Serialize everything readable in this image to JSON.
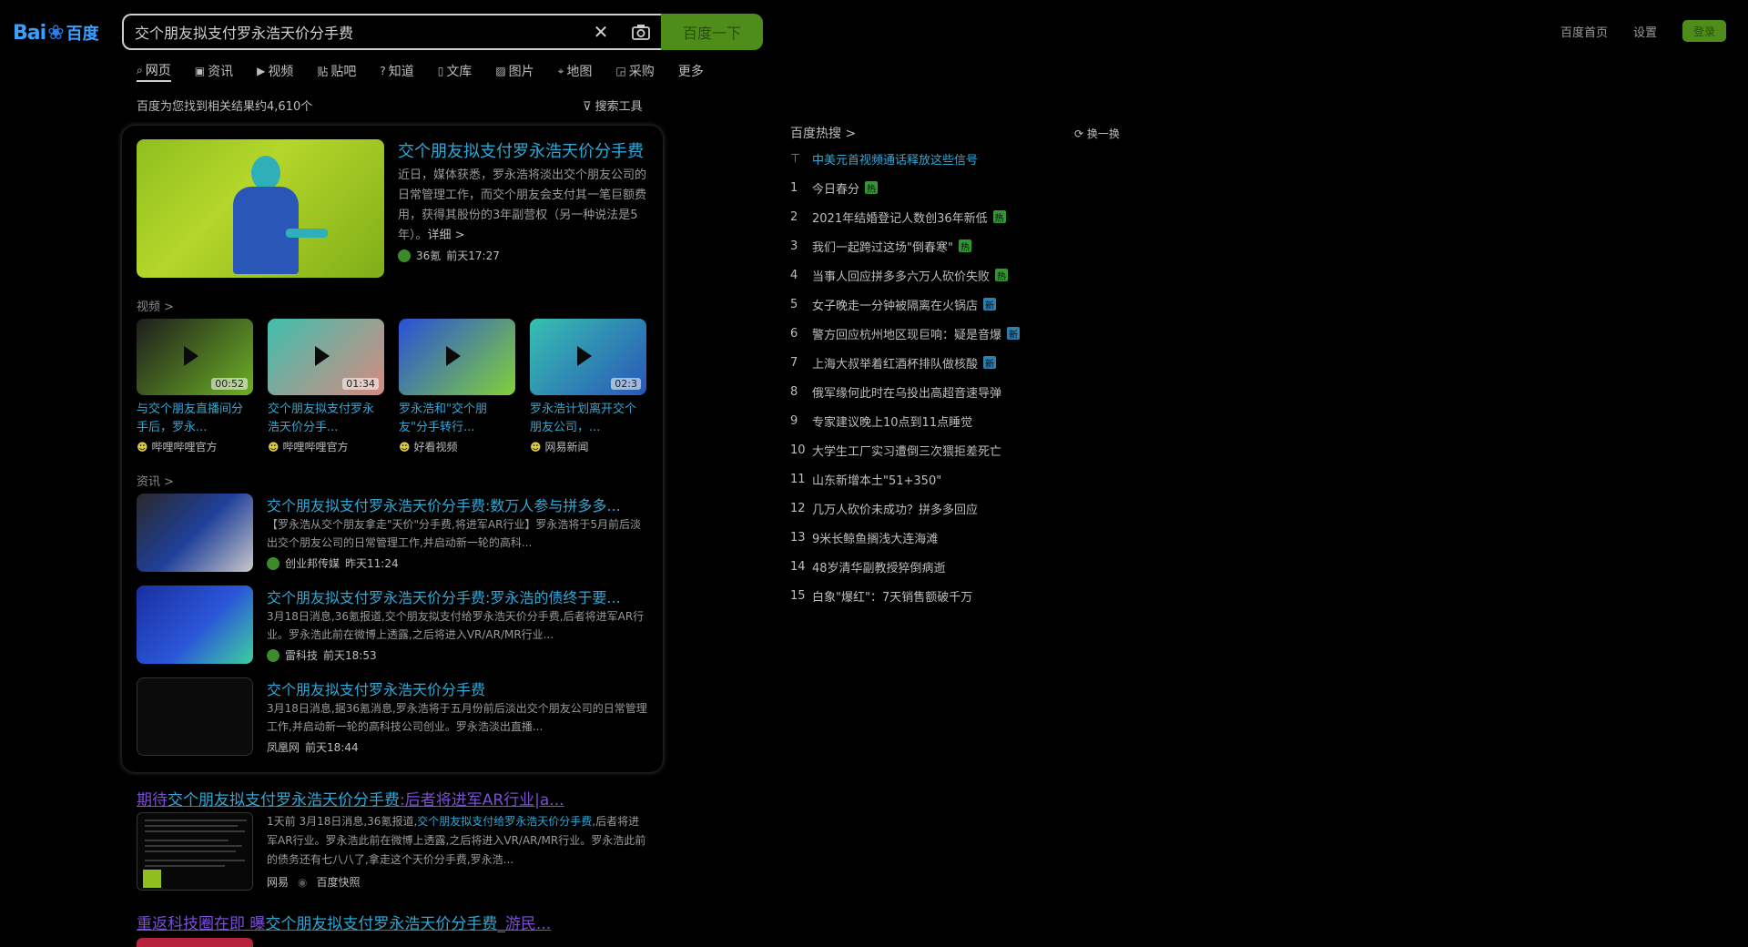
{
  "logo": {
    "text": "Bai",
    "paw": "❀",
    "cn": "百度"
  },
  "search": {
    "query": "交个朋友拟支付罗永浩天价分手费",
    "camera_icon": "camera-icon",
    "clear_icon": "close-icon",
    "button_label": "百度一下"
  },
  "top_links": {
    "home": "百度首页",
    "settings": "设置",
    "login": "登录"
  },
  "tabs": [
    {
      "label": "网页",
      "icon": "⌕"
    },
    {
      "label": "资讯",
      "icon": "▣"
    },
    {
      "label": "视频",
      "icon": "▶"
    },
    {
      "label": "贴吧",
      "icon": "贴"
    },
    {
      "label": "知道",
      "icon": "?"
    },
    {
      "label": "文库",
      "icon": "▯"
    },
    {
      "label": "图片",
      "icon": "▨"
    },
    {
      "label": "地图",
      "icon": "⌖"
    },
    {
      "label": "采购",
      "icon": "◲"
    },
    {
      "label": "更多",
      "icon": ""
    }
  ],
  "result_count": "百度为您找到相关结果约4,610个",
  "search_tools": "搜索工具",
  "top_result": {
    "title": "交个朋友拟支付罗永浩天价分手费",
    "desc": "近日，媒体获悉，罗永浩将淡出交个朋友公司的日常管理工作，而交个朋友会支付其一笔巨额费用，获得其股份的3年副营权（另一种说法是5年）。",
    "more": "详细 >",
    "source": "36氪",
    "time": "前天17:27"
  },
  "video_section_label": "视频 >",
  "videos": [
    {
      "title": "与交个朋友直播间分手后，罗永...",
      "duration": "00:52",
      "source": "哔哩哔哩官方",
      "thumb_colors": [
        "#1d1d1d",
        "#6db025"
      ]
    },
    {
      "title": "交个朋友拟支付罗永浩天价分手...",
      "duration": "01:34",
      "source": "哔哩哔哩官方",
      "thumb_colors": [
        "#3fbfae",
        "#d88a7f"
      ]
    },
    {
      "title": "罗永浩和\"交个朋友\"分手转行...",
      "duration": "",
      "source": "好看视频",
      "thumb_colors": [
        "#2a4fd8",
        "#7fd23a"
      ]
    },
    {
      "title": "罗永浩计划离开交个朋友公司，...",
      "duration": "02:3",
      "source": "网易新闻",
      "thumb_colors": [
        "#36c0b0",
        "#2a56b8"
      ]
    }
  ],
  "news_section_label": "资讯 >",
  "news": [
    {
      "title": "交个朋友拟支付罗永浩天价分手费:数万人参与拼多多...",
      "desc": "【罗永浩从交个朋友拿走\"天价\"分手费,将进军AR行业】罗永浩将于5月前后淡出交个朋友公司的日常管理工作,并启动新一轮的高科...",
      "source": "创业邦传媒",
      "time": "昨天11:24"
    },
    {
      "title": "交个朋友拟支付罗永浩天价分手费:罗永浩的债终于要...",
      "desc": "3月18日消息,36氪报道,交个朋友拟支付给罗永浩天价分手费,后者将进军AR行业。罗永浩此前在微博上透露,之后将进入VR/AR/MR行业...",
      "source": "雷科技",
      "time": "前天18:53"
    },
    {
      "title": "交个朋友拟支付罗永浩天价分手费",
      "desc": "3月18日消息,据36氪消息,罗永浩将于五月份前后淡出交个朋友公司的日常管理工作,并启动新一轮的高科技公司创业。罗永浩淡出直播...",
      "source": "凤凰网",
      "time": "前天18:44"
    }
  ],
  "organic": [
    {
      "title_pre": "期待",
      "title_hl": "交个朋友拟支付罗永浩天价分手费",
      "title_post": ":后者将进军AR行业|a...",
      "desc_pre": "1天前 3月18日消息,36氪报道,",
      "desc_em": "交个朋友拟支付给罗永浩天价分手费",
      "desc_post": ",后者将进军AR行业。罗永浩此前在微博上透露,之后将进入VR/AR/MR行业。罗永浩此前的债务还有七八八了,拿走这个天价分手费,罗永浩...",
      "source": "网易",
      "cache": "百度快照"
    },
    {
      "title_pre": "重返科技圈在即 曝",
      "title_hl": "交个朋友拟支付罗永浩天价分手费",
      "title_post": "_游民..."
    }
  ],
  "hot": {
    "title": "百度热搜 >",
    "refresh": "换一换",
    "items": [
      {
        "rank": "⊤",
        "text": "中美元首视频通话释放这些信号",
        "badge": "",
        "top": true
      },
      {
        "rank": "1",
        "text": "今日春分",
        "badge": "热",
        "badge_color": "#2e9a2e"
      },
      {
        "rank": "2",
        "text": "2021年结婚登记人数创36年新低",
        "badge": "热",
        "badge_color": "#2e9a2e"
      },
      {
        "rank": "3",
        "text": "我们一起跨过这场\"倒春寒\"",
        "badge": "热",
        "badge_color": "#2e9a2e"
      },
      {
        "rank": "4",
        "text": "当事人回应拼多多六万人砍价失败",
        "badge": "热",
        "badge_color": "#2e9a2e"
      },
      {
        "rank": "5",
        "text": "女子晚走一分钟被隔离在火锅店",
        "badge": "新",
        "badge_color": "#2f7fb0"
      },
      {
        "rank": "6",
        "text": "警方回应杭州地区现巨响：疑是音爆",
        "badge": "新",
        "badge_color": "#2f7fb0"
      },
      {
        "rank": "7",
        "text": "上海大叔举着红酒杯排队做核酸",
        "badge": "新",
        "badge_color": "#2f7fb0"
      },
      {
        "rank": "8",
        "text": "俄军缘何此时在乌投出高超音速导弹",
        "badge": ""
      },
      {
        "rank": "9",
        "text": "专家建议晚上10点到11点睡觉",
        "badge": ""
      },
      {
        "rank": "10",
        "text": "大学生工厂实习遭倒三次猥拒差死亡",
        "badge": ""
      },
      {
        "rank": "11",
        "text": "山东新增本土\"51+350\"",
        "badge": ""
      },
      {
        "rank": "12",
        "text": "几万人砍价未成功？拼多多回应",
        "badge": ""
      },
      {
        "rank": "13",
        "text": "9米长鲸鱼搁浅大连海滩",
        "badge": ""
      },
      {
        "rank": "14",
        "text": "48岁清华副教授猝倒病逝",
        "badge": ""
      },
      {
        "rank": "15",
        "text": "白象\"爆红\"：7天销售额破千万",
        "badge": ""
      }
    ]
  }
}
